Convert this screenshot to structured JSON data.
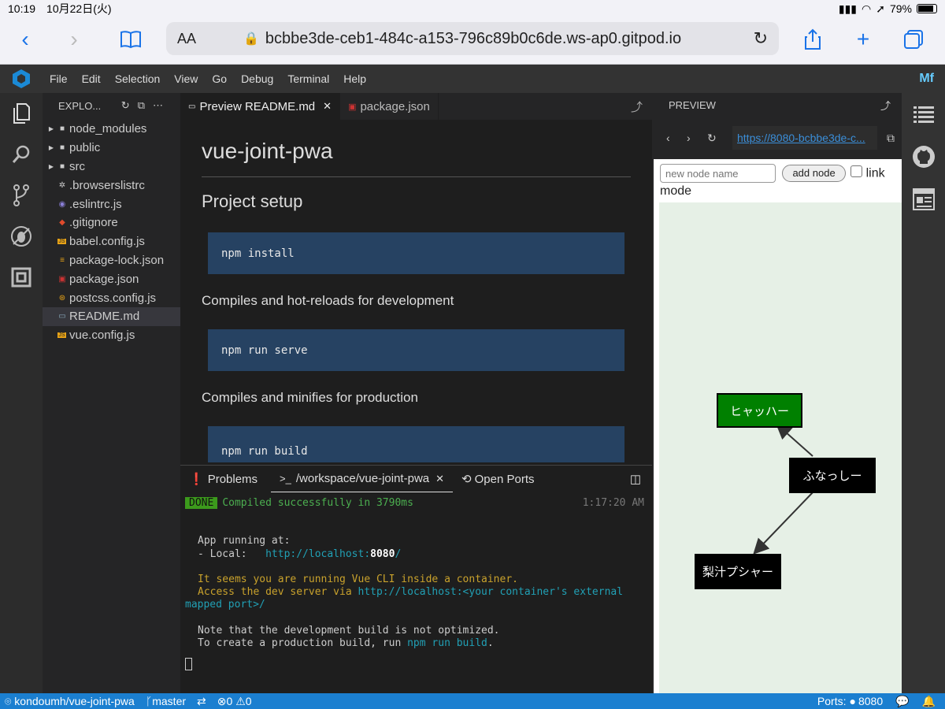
{
  "ios": {
    "time": "10:19",
    "date": "10月22日(火)",
    "battery": "79%"
  },
  "safari": {
    "text_size": "AA",
    "url": "bcbbe3de-ceb1-484c-a153-796c89b0c6de.ws-ap0.gitpod.io"
  },
  "menu": {
    "items": [
      "File",
      "Edit",
      "Selection",
      "View",
      "Go",
      "Debug",
      "Terminal",
      "Help"
    ]
  },
  "explorer": {
    "title": "EXPLO...",
    "items": [
      {
        "label": "node_modules",
        "icon": "folder-icon",
        "folder": true
      },
      {
        "label": "public",
        "icon": "folder-icon",
        "folder": true
      },
      {
        "label": "src",
        "icon": "folder-icon",
        "folder": true
      },
      {
        "label": ".browserslistrc",
        "icon": "gear-icon"
      },
      {
        "label": ".eslintrc.js",
        "icon": "eslint-icon"
      },
      {
        "label": ".gitignore",
        "icon": "git-icon"
      },
      {
        "label": "babel.config.js",
        "icon": "js-icon"
      },
      {
        "label": "package-lock.json",
        "icon": "db-icon"
      },
      {
        "label": "package.json",
        "icon": "npm-icon"
      },
      {
        "label": "postcss.config.js",
        "icon": "postcss-icon"
      },
      {
        "label": "README.md",
        "icon": "markdown-icon",
        "selected": true
      },
      {
        "label": "vue.config.js",
        "icon": "js-icon"
      }
    ]
  },
  "tabs": [
    {
      "label": "Preview README.md",
      "close": "✕"
    },
    {
      "label": "package.json"
    }
  ],
  "readme": {
    "title": "vue-joint-pwa",
    "h2": "Project setup",
    "code1": "npm install",
    "p1": "Compiles and hot-reloads for development",
    "code2": "npm run serve",
    "p2": "Compiles and minifies for production",
    "code3": "npm run build"
  },
  "panel": {
    "tabs": [
      "Problems",
      "/workspace/vue-joint-pwa",
      "Open Ports"
    ],
    "close": "✕",
    "done": "DONE",
    "compiled": "Compiled successfully in 3790ms",
    "time": "1:17:20 AM",
    "l1": "App running at:",
    "l2": "- Local:   ",
    "l2url": "http://localhost:",
    "l2port": "8080",
    "l2end": "/",
    "l3": "It seems you are running Vue CLI inside a container.",
    "l4a": "Access the dev server via ",
    "l4b": "http://localhost:<your container's external",
    "l5": "mapped port>/",
    "l6": "Note that the development build is not optimized.",
    "l7a": "To create a production build, run ",
    "l7b": "npm run build",
    "l7c": "."
  },
  "preview": {
    "title": "PREVIEW",
    "url": "https://8080-bcbbe3de-c...",
    "placeholder": "new node name",
    "add_node": "add node",
    "link": "link",
    "mode": "mode",
    "nodes": [
      {
        "label": "ヒャッハー",
        "color": "#008000"
      },
      {
        "label": "ふなっしー",
        "color": "#000000"
      },
      {
        "label": "梨汁プシャー",
        "color": "#000000"
      }
    ]
  },
  "statusbar": {
    "repo": "kondoumh/vue-joint-pwa",
    "branch": "master",
    "errors": "0",
    "warnings": "0",
    "ports_label": "Ports:",
    "port": "8080"
  }
}
